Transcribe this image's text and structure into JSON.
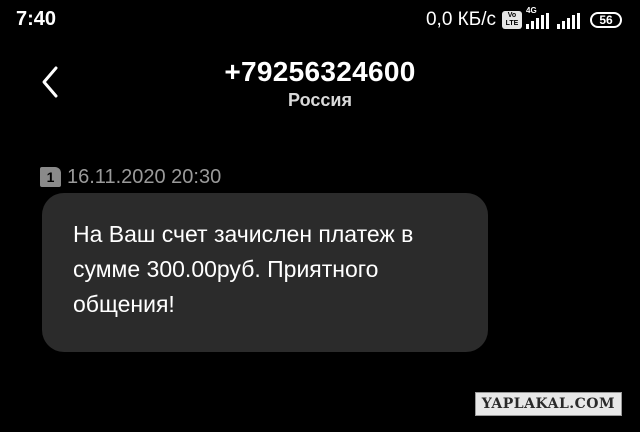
{
  "status_bar": {
    "time": "7:40",
    "net_speed": "0,0 КБ/с",
    "volte_badge": "Vo LTE",
    "signal_tag": "4G",
    "battery": "56"
  },
  "header": {
    "title": "+79256324600",
    "subtitle": "Россия"
  },
  "message": {
    "sim": "1",
    "timestamp": "16.11.2020 20:30",
    "text": "На Ваш счет зачислен платеж в сумме 300.00руб. Приятного общения!"
  },
  "watermark": {
    "text": "YAPLAKAL.COM"
  },
  "icons": {
    "back": "chevron-left-icon",
    "signal": "signal-icon",
    "battery": "battery-icon",
    "sim": "sim-icon"
  },
  "colors": {
    "background": "#000000",
    "bubble": "#2b2b2b",
    "timestamp": "#9a9a9a"
  }
}
